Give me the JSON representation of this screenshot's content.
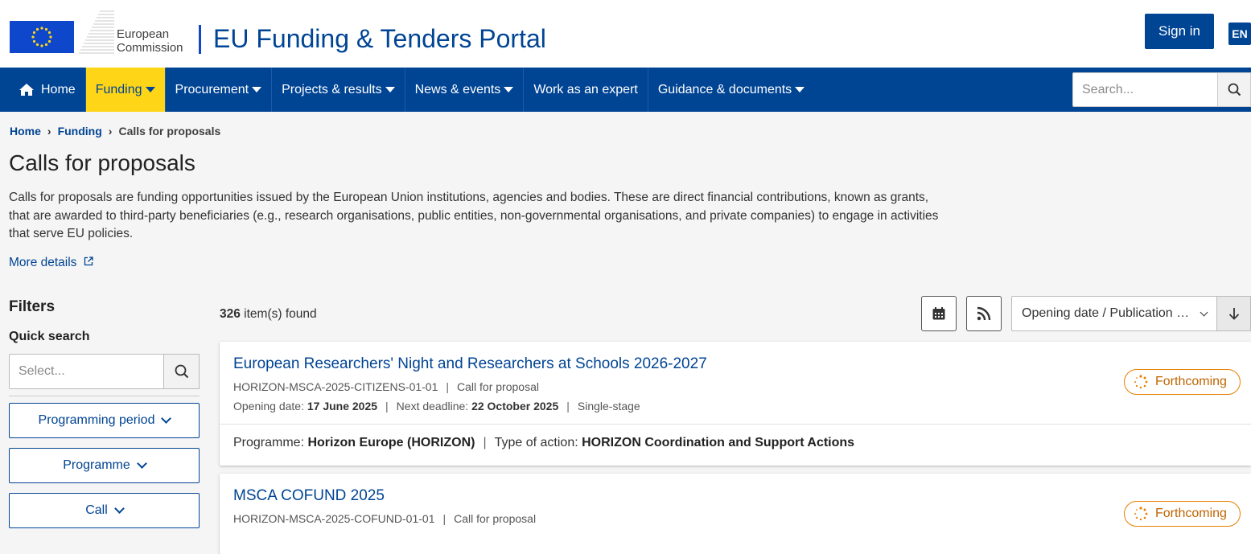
{
  "header": {
    "logo_text_1": "European",
    "logo_text_2": "Commission",
    "portal_title": "EU Funding & Tenders Portal",
    "signin_label": "Sign in",
    "lang": "EN"
  },
  "nav": {
    "items": [
      {
        "label": "Home",
        "icon": "home-icon"
      },
      {
        "label": "Funding",
        "active": true
      },
      {
        "label": "Procurement"
      },
      {
        "label": "Projects & results"
      },
      {
        "label": "News & events"
      },
      {
        "label": "Work as an expert"
      },
      {
        "label": "Guidance & documents"
      }
    ],
    "search_placeholder": "Search..."
  },
  "breadcrumb": {
    "home": "Home",
    "funding": "Funding",
    "current": "Calls for proposals"
  },
  "page": {
    "title": "Calls for proposals",
    "intro": "Calls for proposals are funding opportunities issued by the European Union institutions, agencies and bodies. These are direct financial contributions, known as grants, that are awarded to third-party beneficiaries (e.g., research organisations, public entities, non-governmental organisations, and private companies) to engage in activities that serve EU policies.",
    "more_details": "More details"
  },
  "filters": {
    "title": "Filters",
    "quick_search_title": "Quick search",
    "quick_search_placeholder": "Select...",
    "buttons": [
      "Programming period",
      "Programme",
      "Call"
    ]
  },
  "results": {
    "count": "326",
    "count_suffix": " item(s) found",
    "sort_value": "Opening date / Publication date"
  },
  "cards": [
    {
      "title": "European Researchers' Night and Researchers at Schools 2026-2027",
      "identifier": "HORIZON-MSCA-2025-CITIZENS-01-01",
      "type": "Call for proposal",
      "opening_label": "Opening date: ",
      "opening_date": "17 June 2025",
      "deadline_label": "Next deadline: ",
      "deadline_date": "22 October 2025",
      "stage": "Single-stage",
      "status": "Forthcoming",
      "programme_label": "Programme: ",
      "programme": "Horizon Europe (HORIZON)",
      "action_label": "Type of action: ",
      "action": "HORIZON Coordination and Support Actions"
    },
    {
      "title": "MSCA COFUND 2025",
      "identifier": "HORIZON-MSCA-2025-COFUND-01-01",
      "type": "Call for proposal",
      "status": "Forthcoming"
    }
  ],
  "colors": {
    "primary": "#004494",
    "accent": "#ffd617",
    "status": "#e87e00"
  }
}
